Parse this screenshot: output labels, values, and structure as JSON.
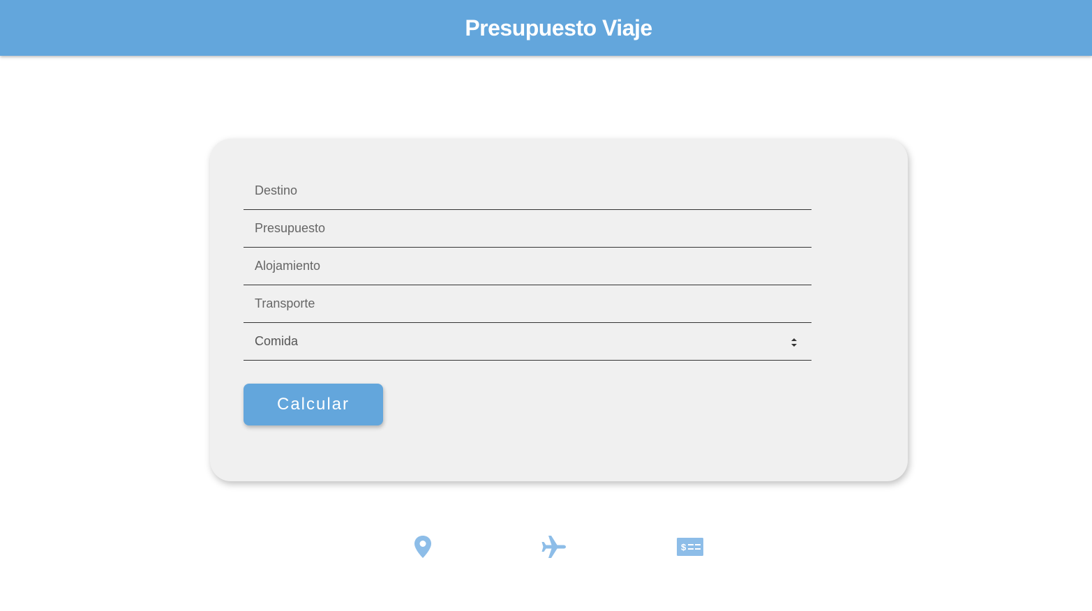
{
  "header": {
    "title": "Presupuesto Viaje"
  },
  "form": {
    "destino_placeholder": "Destino",
    "presupuesto_placeholder": "Presupuesto",
    "alojamiento_placeholder": "Alojamiento",
    "transporte_placeholder": "Transporte",
    "comida_selected": "Comida",
    "calcular_label": "Calcular"
  },
  "footer_icons": [
    {
      "name": "map-pin-icon"
    },
    {
      "name": "airplane-icon"
    },
    {
      "name": "money-bill-icon"
    }
  ],
  "colors": {
    "accent": "#63a6dc",
    "icon": "#8dbde8",
    "card_bg": "#f0f0f0"
  }
}
